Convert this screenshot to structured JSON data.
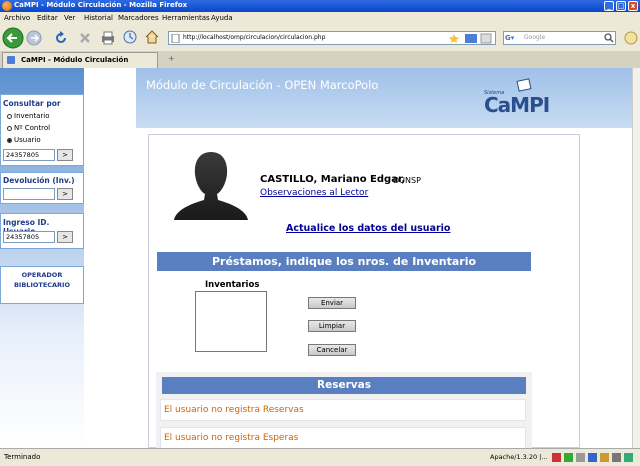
{
  "window": {
    "title": "CaMPI - Módulo Circulación - Mozilla Firefox",
    "minimize": "_",
    "maximize": "□",
    "close": "x"
  },
  "menu": [
    "Archivo",
    "Editar",
    "Ver",
    "Historial",
    "Marcadores",
    "Herramientas",
    "Ayuda"
  ],
  "toolbar": {
    "url": "http://localhost/omp/circulacion/circulacion.php",
    "search_placeholder": "Google"
  },
  "tab": {
    "label": "CaMPI - Módulo Circulación"
  },
  "sidebar": {
    "consultar": {
      "heading": "Consultar por",
      "options": [
        "Inventario",
        "Nº Control",
        "Usuario"
      ],
      "selected": 2,
      "value": "24357805",
      "go": ">"
    },
    "devolucion": {
      "heading": "Devolución (Inv.)",
      "value": "",
      "go": ">"
    },
    "ingreso": {
      "heading": "Ingreso ID. Usuario",
      "value": "24357805",
      "go": ">"
    },
    "operador": {
      "line1": "OPERADOR",
      "line2": "BIBLIOTECARIO"
    }
  },
  "header": {
    "title": "Módulo de Circulación - OPEN MarcoPolo",
    "logo_small": "Sistema",
    "logo_big": "CaMPI"
  },
  "user": {
    "name": "CASTILLO, Mariano Edgar,",
    "unit": "DUNSP",
    "observations_link": "Observaciones al Lector",
    "update_link": "Actualice los datos del usuario"
  },
  "prestamos": {
    "heading": "Préstamos, indique los nros. de Inventario",
    "inventory_label": "Inventarios",
    "buttons": {
      "send": "Enviar",
      "clear": "Limpiar",
      "cancel": "Cancelar"
    }
  },
  "reservas": {
    "heading": "Reservas",
    "no_reservas": "El usuario no registra Reservas",
    "no_esperas": "El usuario no registra Esperas"
  },
  "status": {
    "left": "Terminado",
    "right": "Apache/1.3.20 |..."
  },
  "colors": {
    "accent": "#5a7fc0",
    "header_bg": "#b3cdee",
    "warning_text": "#cc6600",
    "link": "#000099"
  }
}
